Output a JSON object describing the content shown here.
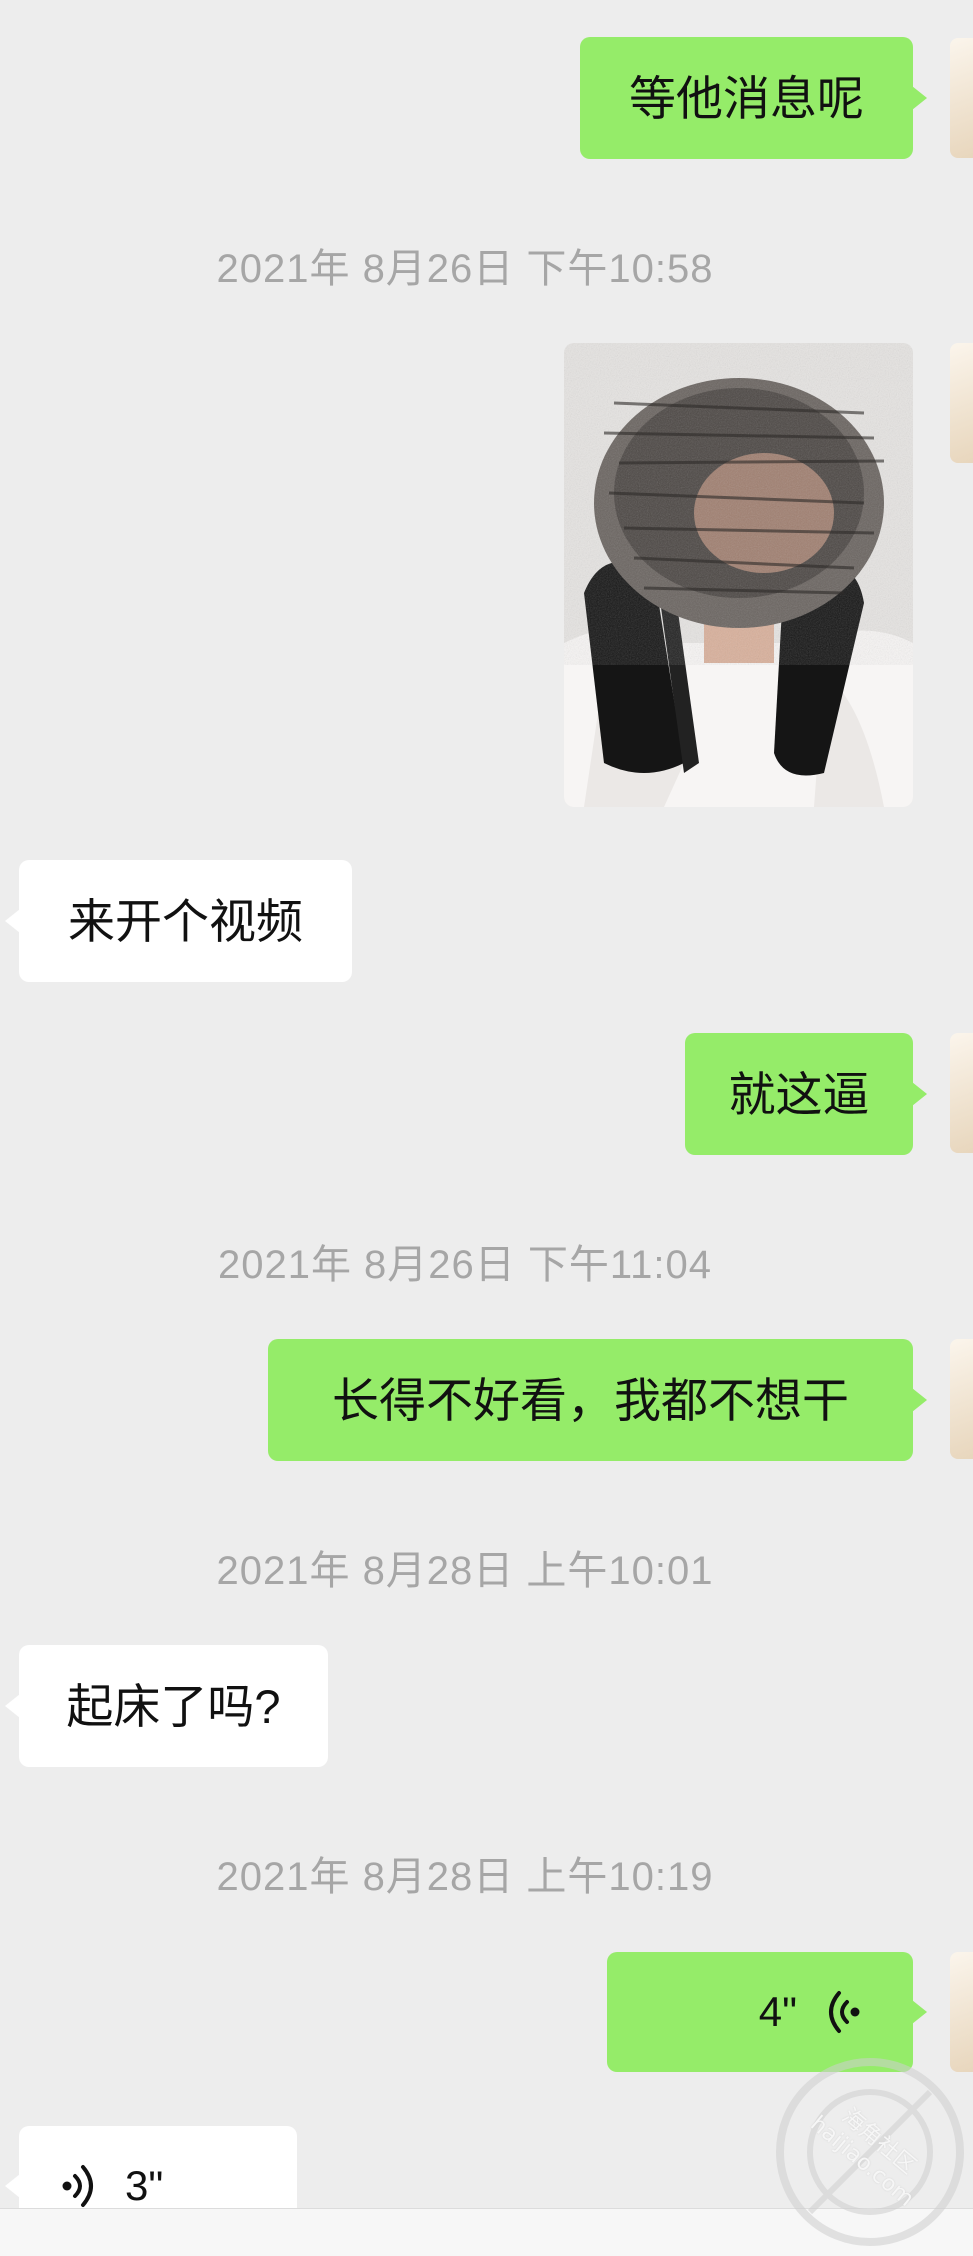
{
  "messages": {
    "m1": "等他消息呢",
    "m3": "来开个视频",
    "m4": "就这逼",
    "m5": "长得不好看，我都不想干",
    "m6": "起床了吗?"
  },
  "timestamps": {
    "t1": "2021年 8月26日 下午10:58",
    "t2": "2021年 8月26日 下午11:04",
    "t3": "2021年 8月28日 上午10:01",
    "t4": "2021年 8月28日 上午10:19"
  },
  "voice": {
    "outgoing_duration": "4\"",
    "incoming_duration": "3\""
  },
  "watermark": {
    "line1": "海角社区",
    "line2": "haijiao.com"
  },
  "colors": {
    "background": "#ededed",
    "outgoing_bubble": "#95ec69",
    "incoming_bubble": "#ffffff",
    "timestamp_text": "#a6a6a6"
  }
}
